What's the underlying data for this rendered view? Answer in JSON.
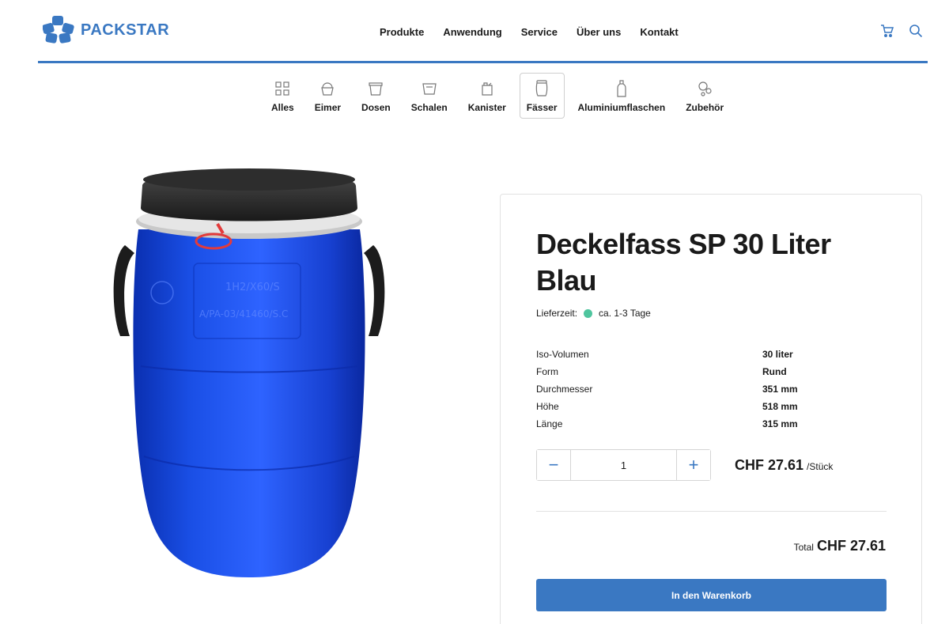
{
  "brand": {
    "name": "PACKSTAR",
    "color": "#3a78c2"
  },
  "nav": [
    {
      "label": "Produkte"
    },
    {
      "label": "Anwendung"
    },
    {
      "label": "Service"
    },
    {
      "label": "Über uns"
    },
    {
      "label": "Kontakt"
    }
  ],
  "header_icons": [
    "cart-icon",
    "search-icon"
  ],
  "categories": [
    {
      "label": "Alles",
      "icon": "grid-icon"
    },
    {
      "label": "Eimer",
      "icon": "bucket-icon"
    },
    {
      "label": "Dosen",
      "icon": "can-icon"
    },
    {
      "label": "Schalen",
      "icon": "tray-icon"
    },
    {
      "label": "Kanister",
      "icon": "canister-icon"
    },
    {
      "label": "Fässer",
      "icon": "barrel-icon",
      "active": true
    },
    {
      "label": "Aluminiumflaschen",
      "icon": "bottle-icon"
    },
    {
      "label": "Zubehör",
      "icon": "accessories-icon"
    }
  ],
  "product": {
    "title": "Deckelfass SP 30 Liter Blau",
    "delivery_label": "Lieferzeit:",
    "delivery_value": "ca. 1-3 Tage",
    "delivery_status_color": "#4fc59e",
    "specs": [
      {
        "label": "Iso-Volumen",
        "value": "30 liter"
      },
      {
        "label": "Form",
        "value": "Rund"
      },
      {
        "label": "Durchmesser",
        "value": "351 mm"
      },
      {
        "label": "Höhe",
        "value": "518 mm"
      },
      {
        "label": "Länge",
        "value": "315 mm"
      }
    ],
    "quantity": "1",
    "decrement": "−",
    "increment": "+",
    "price": "CHF 27.61",
    "price_unit": "/Stück",
    "total_label": "Total",
    "total_value": "CHF 27.61",
    "add_to_cart": "In den Warenkorb",
    "barrel_embossing": [
      "1H2/X60/S",
      "A/PA-03/41460/S.C"
    ]
  }
}
